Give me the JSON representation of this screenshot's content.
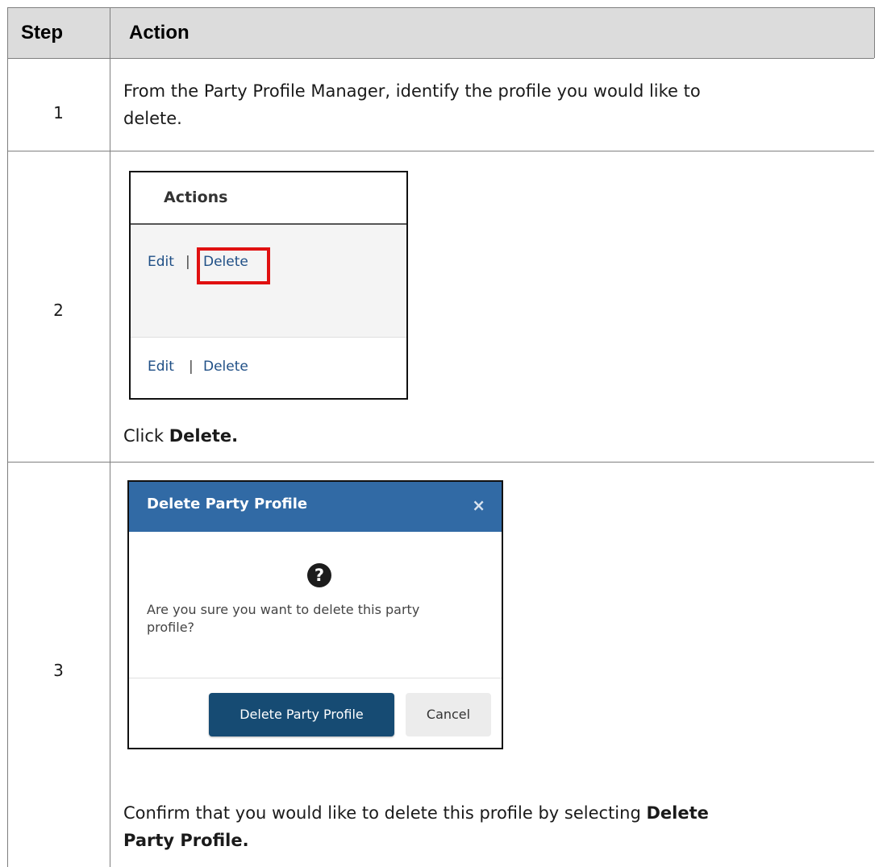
{
  "table": {
    "headers": {
      "step": "Step",
      "action": "Action"
    },
    "rows": [
      {
        "step": "1",
        "line1": "From the Party Profile Manager, identify the profile you would like to",
        "line2": "delete."
      },
      {
        "step": "2",
        "caption_prefix": "Click ",
        "caption_bold": "Delete."
      },
      {
        "step": "3",
        "caption_line1_prefix": "Confirm that you would like to delete this profile by selecting ",
        "caption_line1_bold": "Delete",
        "caption_line2_bold": "Party Profile."
      }
    ]
  },
  "actions_screenshot": {
    "column_header": "Actions",
    "rows": [
      {
        "edit": "Edit",
        "separator": "|",
        "delete": "Delete"
      },
      {
        "edit": "Edit",
        "separator": "|",
        "delete": "Delete"
      }
    ],
    "highlight_color": "#e01010"
  },
  "dialog": {
    "title": "Delete Party Profile",
    "close_glyph": "×",
    "icon": "question-circle-icon",
    "icon_glyph": "?",
    "message_line1": "Are you sure you want to delete this party",
    "message_line2": "profile?",
    "confirm_label": "Delete Party Profile",
    "cancel_label": "Cancel",
    "header_color": "#316aa5",
    "confirm_color": "#164b73"
  }
}
